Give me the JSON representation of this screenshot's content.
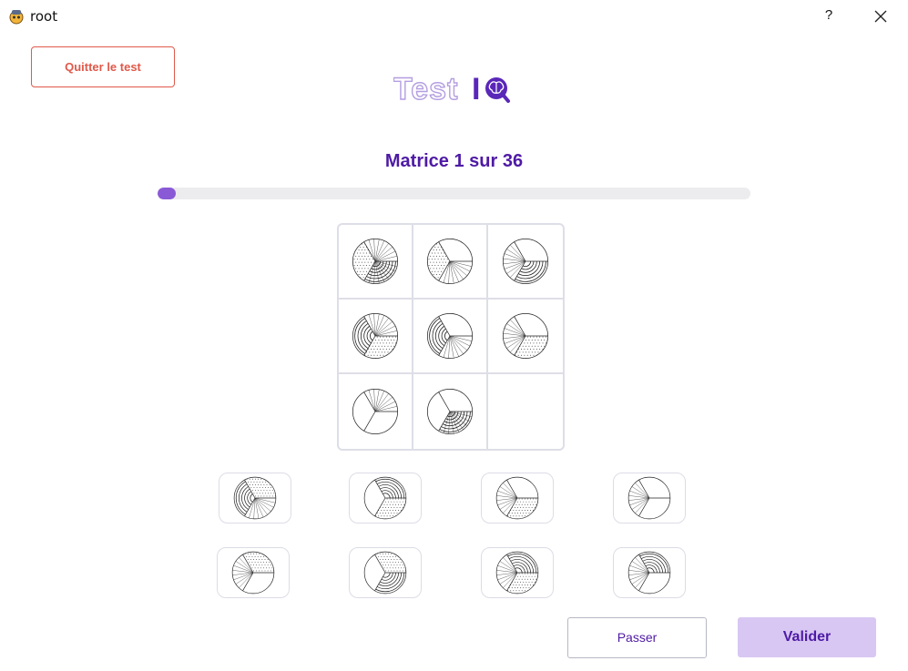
{
  "window": {
    "title": "root",
    "help_label": "?"
  },
  "header": {
    "quit_label": "Quitter le test",
    "logo_text": "TestIQ"
  },
  "matrix": {
    "title": "Matrice 1 sur 36",
    "current": 1,
    "total": 36,
    "progress_fraction": 0.03
  },
  "footer": {
    "skip_label": "Passer",
    "validate_label": "Valider"
  },
  "colors": {
    "accent": "#4e1aa5",
    "quit": "#e0594a",
    "validate_bg": "#d8c7f2",
    "logo_light": "#b49ee0"
  },
  "grid_cells": [
    {
      "sectors": [
        "arcs-lines",
        "dots",
        "lines"
      ]
    },
    {
      "sectors": [
        "lines",
        "dots",
        "blank"
      ]
    },
    {
      "sectors": [
        "arcs",
        "lines",
        "blank"
      ]
    },
    {
      "sectors": [
        "dots",
        "arcs",
        "lines"
      ]
    },
    {
      "sectors": [
        "lines",
        "arcs",
        "blank"
      ]
    },
    {
      "sectors": [
        "dots",
        "lines",
        "blank"
      ]
    },
    {
      "sectors": [
        "blank",
        "blank",
        "lines"
      ]
    },
    {
      "sectors": [
        "arcs-lines",
        "blank",
        "blank"
      ]
    },
    {
      "sectors": []
    }
  ],
  "options": [
    {
      "sectors": [
        "lines",
        "arcs",
        "dots"
      ]
    },
    {
      "sectors": [
        "dots",
        "blank",
        "arcs"
      ]
    },
    {
      "sectors": [
        "dots",
        "lines",
        "blank"
      ]
    },
    {
      "sectors": [
        "blank",
        "lines",
        "blank"
      ]
    },
    {
      "sectors": [
        "blank",
        "lines",
        "dots"
      ]
    },
    {
      "sectors": [
        "arcs",
        "blank",
        "dots"
      ]
    },
    {
      "sectors": [
        "dots",
        "lines",
        "arcs"
      ]
    },
    {
      "sectors": [
        "blank",
        "lines",
        "arcs"
      ]
    }
  ]
}
